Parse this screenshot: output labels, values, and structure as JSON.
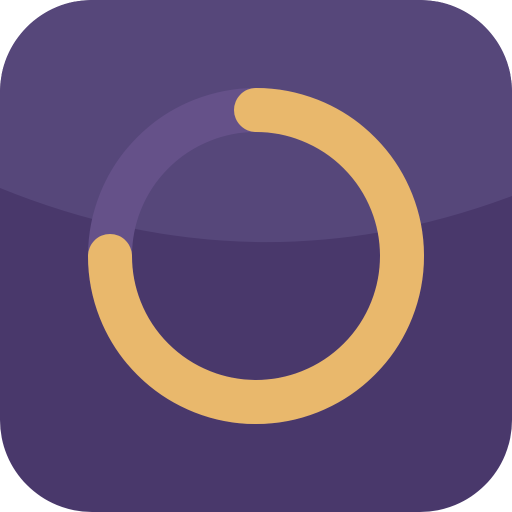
{
  "icon": {
    "name": "progress-ring-app-icon",
    "shape": "rounded-square",
    "glyph": "circular-progress-ring",
    "progress_fraction": 0.75
  },
  "colors": {
    "background": "#49386b",
    "gloss_highlight": "#56477a",
    "ring_track": "#655189",
    "ring_progress": "#e9b86c"
  }
}
